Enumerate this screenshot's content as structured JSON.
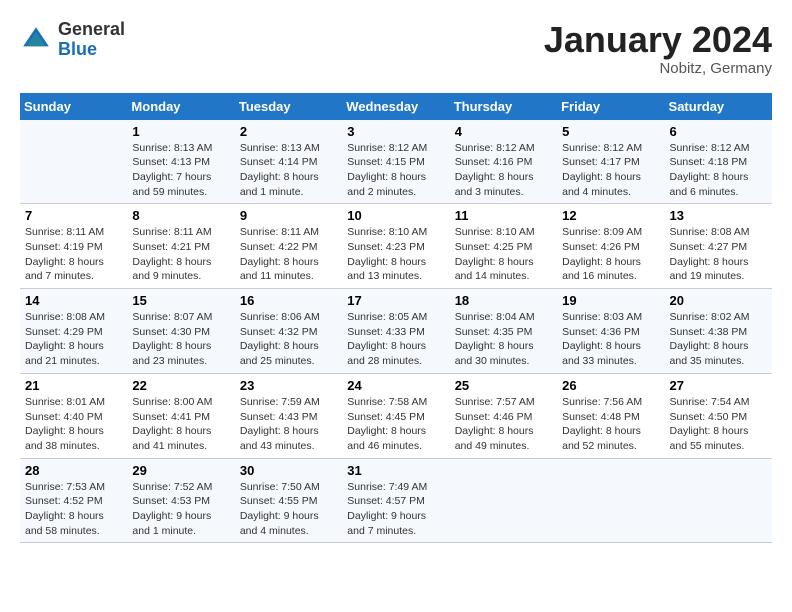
{
  "header": {
    "logo_general": "General",
    "logo_blue": "Blue",
    "month_title": "January 2024",
    "location": "Nobitz, Germany"
  },
  "days_of_week": [
    "Sunday",
    "Monday",
    "Tuesday",
    "Wednesday",
    "Thursday",
    "Friday",
    "Saturday"
  ],
  "weeks": [
    [
      {
        "day": "",
        "info": ""
      },
      {
        "day": "1",
        "info": "Sunrise: 8:13 AM\nSunset: 4:13 PM\nDaylight: 7 hours\nand 59 minutes."
      },
      {
        "day": "2",
        "info": "Sunrise: 8:13 AM\nSunset: 4:14 PM\nDaylight: 8 hours\nand 1 minute."
      },
      {
        "day": "3",
        "info": "Sunrise: 8:12 AM\nSunset: 4:15 PM\nDaylight: 8 hours\nand 2 minutes."
      },
      {
        "day": "4",
        "info": "Sunrise: 8:12 AM\nSunset: 4:16 PM\nDaylight: 8 hours\nand 3 minutes."
      },
      {
        "day": "5",
        "info": "Sunrise: 8:12 AM\nSunset: 4:17 PM\nDaylight: 8 hours\nand 4 minutes."
      },
      {
        "day": "6",
        "info": "Sunrise: 8:12 AM\nSunset: 4:18 PM\nDaylight: 8 hours\nand 6 minutes."
      }
    ],
    [
      {
        "day": "7",
        "info": "Sunrise: 8:11 AM\nSunset: 4:19 PM\nDaylight: 8 hours\nand 7 minutes."
      },
      {
        "day": "8",
        "info": "Sunrise: 8:11 AM\nSunset: 4:21 PM\nDaylight: 8 hours\nand 9 minutes."
      },
      {
        "day": "9",
        "info": "Sunrise: 8:11 AM\nSunset: 4:22 PM\nDaylight: 8 hours\nand 11 minutes."
      },
      {
        "day": "10",
        "info": "Sunrise: 8:10 AM\nSunset: 4:23 PM\nDaylight: 8 hours\nand 13 minutes."
      },
      {
        "day": "11",
        "info": "Sunrise: 8:10 AM\nSunset: 4:25 PM\nDaylight: 8 hours\nand 14 minutes."
      },
      {
        "day": "12",
        "info": "Sunrise: 8:09 AM\nSunset: 4:26 PM\nDaylight: 8 hours\nand 16 minutes."
      },
      {
        "day": "13",
        "info": "Sunrise: 8:08 AM\nSunset: 4:27 PM\nDaylight: 8 hours\nand 19 minutes."
      }
    ],
    [
      {
        "day": "14",
        "info": "Sunrise: 8:08 AM\nSunset: 4:29 PM\nDaylight: 8 hours\nand 21 minutes."
      },
      {
        "day": "15",
        "info": "Sunrise: 8:07 AM\nSunset: 4:30 PM\nDaylight: 8 hours\nand 23 minutes."
      },
      {
        "day": "16",
        "info": "Sunrise: 8:06 AM\nSunset: 4:32 PM\nDaylight: 8 hours\nand 25 minutes."
      },
      {
        "day": "17",
        "info": "Sunrise: 8:05 AM\nSunset: 4:33 PM\nDaylight: 8 hours\nand 28 minutes."
      },
      {
        "day": "18",
        "info": "Sunrise: 8:04 AM\nSunset: 4:35 PM\nDaylight: 8 hours\nand 30 minutes."
      },
      {
        "day": "19",
        "info": "Sunrise: 8:03 AM\nSunset: 4:36 PM\nDaylight: 8 hours\nand 33 minutes."
      },
      {
        "day": "20",
        "info": "Sunrise: 8:02 AM\nSunset: 4:38 PM\nDaylight: 8 hours\nand 35 minutes."
      }
    ],
    [
      {
        "day": "21",
        "info": "Sunrise: 8:01 AM\nSunset: 4:40 PM\nDaylight: 8 hours\nand 38 minutes."
      },
      {
        "day": "22",
        "info": "Sunrise: 8:00 AM\nSunset: 4:41 PM\nDaylight: 8 hours\nand 41 minutes."
      },
      {
        "day": "23",
        "info": "Sunrise: 7:59 AM\nSunset: 4:43 PM\nDaylight: 8 hours\nand 43 minutes."
      },
      {
        "day": "24",
        "info": "Sunrise: 7:58 AM\nSunset: 4:45 PM\nDaylight: 8 hours\nand 46 minutes."
      },
      {
        "day": "25",
        "info": "Sunrise: 7:57 AM\nSunset: 4:46 PM\nDaylight: 8 hours\nand 49 minutes."
      },
      {
        "day": "26",
        "info": "Sunrise: 7:56 AM\nSunset: 4:48 PM\nDaylight: 8 hours\nand 52 minutes."
      },
      {
        "day": "27",
        "info": "Sunrise: 7:54 AM\nSunset: 4:50 PM\nDaylight: 8 hours\nand 55 minutes."
      }
    ],
    [
      {
        "day": "28",
        "info": "Sunrise: 7:53 AM\nSunset: 4:52 PM\nDaylight: 8 hours\nand 58 minutes."
      },
      {
        "day": "29",
        "info": "Sunrise: 7:52 AM\nSunset: 4:53 PM\nDaylight: 9 hours\nand 1 minute."
      },
      {
        "day": "30",
        "info": "Sunrise: 7:50 AM\nSunset: 4:55 PM\nDaylight: 9 hours\nand 4 minutes."
      },
      {
        "day": "31",
        "info": "Sunrise: 7:49 AM\nSunset: 4:57 PM\nDaylight: 9 hours\nand 7 minutes."
      },
      {
        "day": "",
        "info": ""
      },
      {
        "day": "",
        "info": ""
      },
      {
        "day": "",
        "info": ""
      }
    ]
  ]
}
